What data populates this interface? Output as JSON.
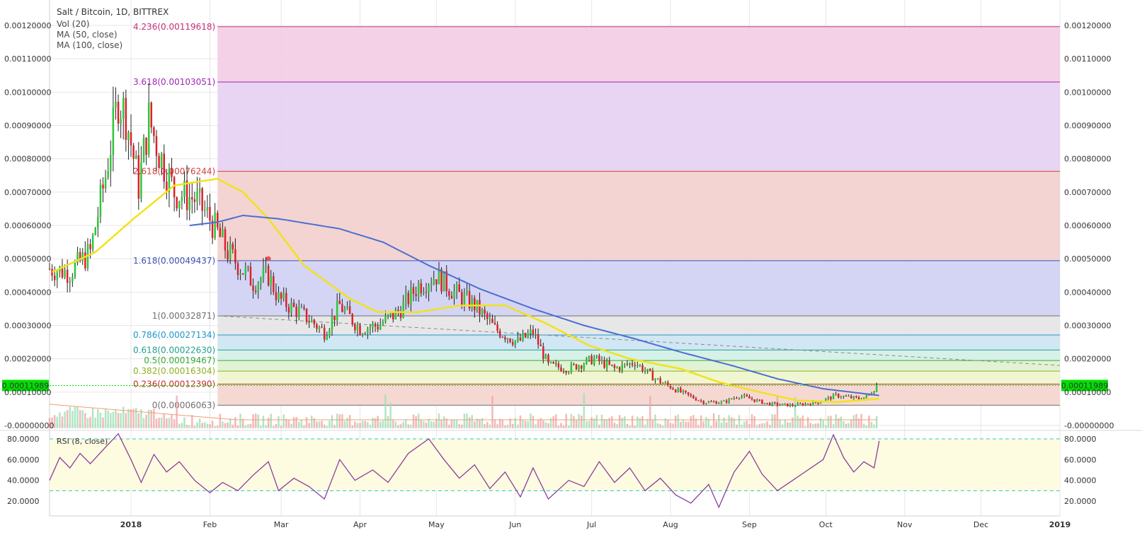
{
  "header": {
    "title": "Salt / Bitcoin, 1D, BITTREX",
    "indicators": [
      "Vol (20)",
      "MA (50, close)",
      "MA (100, close)"
    ]
  },
  "colors": {
    "up": "#2ec63a",
    "down": "#e0202a",
    "ma50": "#f2e21a",
    "ma100": "#4a6fd0",
    "rsi": "#8a3d9c",
    "price_tag": "#00e000",
    "grid": "#e6e6e6"
  },
  "price_tag": "0.00011989",
  "chart_data": [
    {
      "type": "candlestick",
      "title": "Salt / Bitcoin, 1D, BITTREX",
      "x_ticks": [
        "2018",
        "Feb",
        "Mar",
        "Apr",
        "May",
        "Jun",
        "Jul",
        "Aug",
        "Sep",
        "Oct",
        "Nov",
        "Dec",
        "2019"
      ],
      "y_ticks": [
        "0.00120000",
        "0.00110000",
        "0.00100000",
        "0.00090000",
        "0.00080000",
        "0.00070000",
        "0.00060000",
        "0.00050000",
        "0.00040000",
        "0.00030000",
        "0.00020000",
        "0.00010000",
        "-0.00000000"
      ],
      "y_tick_values": [
        0.0012,
        0.0011,
        0.001,
        0.0009,
        0.0008,
        0.0007,
        0.0006,
        0.0005,
        0.0004,
        0.0003,
        0.0002,
        0.0001,
        0.0
      ],
      "ylim": [
        -3.1e-07,
        0.00121
      ],
      "x_range": [
        "2017-11-30",
        "2019-01-01"
      ],
      "last_price": 0.00011989,
      "fib_levels": [
        {
          "label": "4.236(0.00119618)",
          "value": 0.00119618,
          "color": "#c8307a"
        },
        {
          "label": "3.618(0.00103051)",
          "value": 0.00103051,
          "color": "#9c27b0"
        },
        {
          "label": "2.618(0.00076244)",
          "value": 0.00076244,
          "color": "#d04040"
        },
        {
          "label": "1.618(0.00049437)",
          "value": 0.00049437,
          "color": "#3f51b5"
        },
        {
          "label": "1(0.00032871)",
          "value": 0.00032871,
          "color": "#707070"
        },
        {
          "label": "0.786(0.00027134)",
          "value": 0.00027134,
          "color": "#2196c8"
        },
        {
          "label": "0.618(0.00022630)",
          "value": 0.0002263,
          "color": "#20a090"
        },
        {
          "label": "0.5(0.00019467)",
          "value": 0.00019467,
          "color": "#3aa83a"
        },
        {
          "label": "0.382(0.00016304)",
          "value": 0.00016304,
          "color": "#90b020"
        },
        {
          "label": "0.236(0.00012390)",
          "value": 0.0001239,
          "color": "#c0302a"
        },
        {
          "label": "0(0.00006063)",
          "value": 6.063e-05,
          "color": "#707070"
        }
      ],
      "fib_start": "2018-02-04",
      "trendline": {
        "from": [
          "2018-02-04",
          0.00032871
        ],
        "to": [
          "2019-01-01",
          0.00018
        ]
      },
      "anchor_marker": [
        "2018-02-24",
        0.0005
      ],
      "price_keypoints": [
        [
          "2017-11-30",
          0.00047
        ],
        [
          "2017-12-08",
          0.00046
        ],
        [
          "2017-12-16",
          0.00052
        ],
        [
          "2017-12-22",
          0.00075
        ],
        [
          "2017-12-27",
          0.00098
        ],
        [
          "2017-12-30",
          0.00093
        ],
        [
          "2018-01-04",
          0.00072
        ],
        [
          "2018-01-08",
          0.00092
        ],
        [
          "2018-01-12",
          0.00082
        ],
        [
          "2018-01-18",
          0.0007
        ],
        [
          "2018-01-26",
          0.00068
        ],
        [
          "2018-02-01",
          0.00062
        ],
        [
          "2018-02-08",
          0.00052
        ],
        [
          "2018-02-18",
          0.00043
        ],
        [
          "2018-02-24",
          0.00045
        ],
        [
          "2018-02-28",
          0.00038
        ],
        [
          "2018-03-10",
          0.00033
        ],
        [
          "2018-03-18",
          0.00028
        ],
        [
          "2018-03-24",
          0.00036
        ],
        [
          "2018-04-01",
          0.00029
        ],
        [
          "2018-04-08",
          0.0003
        ],
        [
          "2018-04-16",
          0.00034
        ],
        [
          "2018-04-24",
          0.00042
        ],
        [
          "2018-05-01",
          0.00045
        ],
        [
          "2018-05-08",
          0.0004
        ],
        [
          "2018-05-16",
          0.00036
        ],
        [
          "2018-05-24",
          0.00029
        ],
        [
          "2018-06-02",
          0.00025
        ],
        [
          "2018-06-08",
          0.00028
        ],
        [
          "2018-06-14",
          0.00018
        ],
        [
          "2018-06-22",
          0.00017
        ],
        [
          "2018-07-02",
          0.0002
        ],
        [
          "2018-07-10",
          0.00017
        ],
        [
          "2018-07-18",
          0.00019
        ],
        [
          "2018-07-26",
          0.00014
        ],
        [
          "2018-08-05",
          0.0001
        ],
        [
          "2018-08-14",
          7e-05
        ],
        [
          "2018-08-22",
          7e-05
        ],
        [
          "2018-08-28",
          9e-05
        ],
        [
          "2018-09-08",
          6.5e-05
        ],
        [
          "2018-09-18",
          6e-05
        ],
        [
          "2018-09-28",
          7e-05
        ],
        [
          "2018-10-05",
          9e-05
        ],
        [
          "2018-10-14",
          8e-05
        ],
        [
          "2018-10-18",
          9e-05
        ],
        [
          "2018-10-21",
          0.00012
        ]
      ],
      "ma50_keypoints": [
        [
          "2017-12-01",
          0.00046
        ],
        [
          "2017-12-18",
          0.00052
        ],
        [
          "2018-01-02",
          0.00062
        ],
        [
          "2018-01-18",
          0.00072
        ],
        [
          "2018-02-04",
          0.00074
        ],
        [
          "2018-02-14",
          0.0007
        ],
        [
          "2018-02-24",
          0.00062
        ],
        [
          "2018-03-10",
          0.00048
        ],
        [
          "2018-03-28",
          0.00038
        ],
        [
          "2018-04-08",
          0.00034
        ],
        [
          "2018-04-24",
          0.00034
        ],
        [
          "2018-05-10",
          0.00036
        ],
        [
          "2018-05-28",
          0.00036
        ],
        [
          "2018-06-12",
          0.00031
        ],
        [
          "2018-06-30",
          0.00024
        ],
        [
          "2018-07-16",
          0.0002
        ],
        [
          "2018-08-05",
          0.00017
        ],
        [
          "2018-08-20",
          0.00013
        ],
        [
          "2018-09-05",
          0.0001
        ],
        [
          "2018-09-20",
          7.5e-05
        ],
        [
          "2018-10-05",
          7e-05
        ],
        [
          "2018-10-22",
          8e-05
        ]
      ],
      "ma100_keypoints": [
        [
          "2018-01-24",
          0.0006
        ],
        [
          "2018-02-04",
          0.00061
        ],
        [
          "2018-02-14",
          0.00063
        ],
        [
          "2018-02-28",
          0.00062
        ],
        [
          "2018-03-24",
          0.00059
        ],
        [
          "2018-04-10",
          0.00055
        ],
        [
          "2018-04-28",
          0.00048
        ],
        [
          "2018-05-18",
          0.00041
        ],
        [
          "2018-06-08",
          0.00035
        ],
        [
          "2018-06-28",
          0.0003
        ],
        [
          "2018-07-18",
          0.00026
        ],
        [
          "2018-08-05",
          0.00022
        ],
        [
          "2018-08-25",
          0.00018
        ],
        [
          "2018-09-12",
          0.00014
        ],
        [
          "2018-09-30",
          0.00011
        ],
        [
          "2018-10-22",
          9e-05
        ]
      ]
    },
    {
      "type": "line",
      "title": "RSI (8, close)",
      "y_ticks": [
        "80.0000",
        "60.0000",
        "40.0000",
        "20.0000"
      ],
      "y_tick_values": [
        80,
        60,
        40,
        20
      ],
      "ylim": [
        10,
        88
      ],
      "bands": [
        80,
        30
      ],
      "rsi_keypoints": [
        [
          "2017-11-30",
          40
        ],
        [
          "2017-12-04",
          62
        ],
        [
          "2017-12-08",
          52
        ],
        [
          "2017-12-12",
          66
        ],
        [
          "2017-12-16",
          56
        ],
        [
          "2017-12-22",
          72
        ],
        [
          "2017-12-27",
          85
        ],
        [
          "2018-01-01",
          60
        ],
        [
          "2018-01-05",
          38
        ],
        [
          "2018-01-10",
          65
        ],
        [
          "2018-01-15",
          48
        ],
        [
          "2018-01-20",
          58
        ],
        [
          "2018-01-26",
          40
        ],
        [
          "2018-02-01",
          28
        ],
        [
          "2018-02-06",
          38
        ],
        [
          "2018-02-12",
          30
        ],
        [
          "2018-02-18",
          45
        ],
        [
          "2018-02-24",
          58
        ],
        [
          "2018-02-28",
          30
        ],
        [
          "2018-03-06",
          42
        ],
        [
          "2018-03-12",
          34
        ],
        [
          "2018-03-18",
          22
        ],
        [
          "2018-03-24",
          60
        ],
        [
          "2018-03-30",
          40
        ],
        [
          "2018-04-06",
          50
        ],
        [
          "2018-04-12",
          38
        ],
        [
          "2018-04-20",
          66
        ],
        [
          "2018-04-28",
          80
        ],
        [
          "2018-05-04",
          60
        ],
        [
          "2018-05-10",
          42
        ],
        [
          "2018-05-16",
          55
        ],
        [
          "2018-05-22",
          32
        ],
        [
          "2018-05-28",
          48
        ],
        [
          "2018-06-03",
          24
        ],
        [
          "2018-06-08",
          52
        ],
        [
          "2018-06-14",
          22
        ],
        [
          "2018-06-22",
          40
        ],
        [
          "2018-06-28",
          34
        ],
        [
          "2018-07-04",
          58
        ],
        [
          "2018-07-10",
          38
        ],
        [
          "2018-07-16",
          52
        ],
        [
          "2018-07-22",
          30
        ],
        [
          "2018-07-28",
          42
        ],
        [
          "2018-08-03",
          26
        ],
        [
          "2018-08-09",
          18
        ],
        [
          "2018-08-16",
          36
        ],
        [
          "2018-08-20",
          14
        ],
        [
          "2018-08-26",
          48
        ],
        [
          "2018-09-01",
          68
        ],
        [
          "2018-09-06",
          46
        ],
        [
          "2018-09-12",
          30
        ],
        [
          "2018-09-18",
          40
        ],
        [
          "2018-09-24",
          50
        ],
        [
          "2018-09-30",
          60
        ],
        [
          "2018-10-04",
          84
        ],
        [
          "2018-10-08",
          62
        ],
        [
          "2018-10-12",
          48
        ],
        [
          "2018-10-16",
          58
        ],
        [
          "2018-10-20",
          52
        ],
        [
          "2018-10-22",
          78
        ]
      ]
    }
  ]
}
